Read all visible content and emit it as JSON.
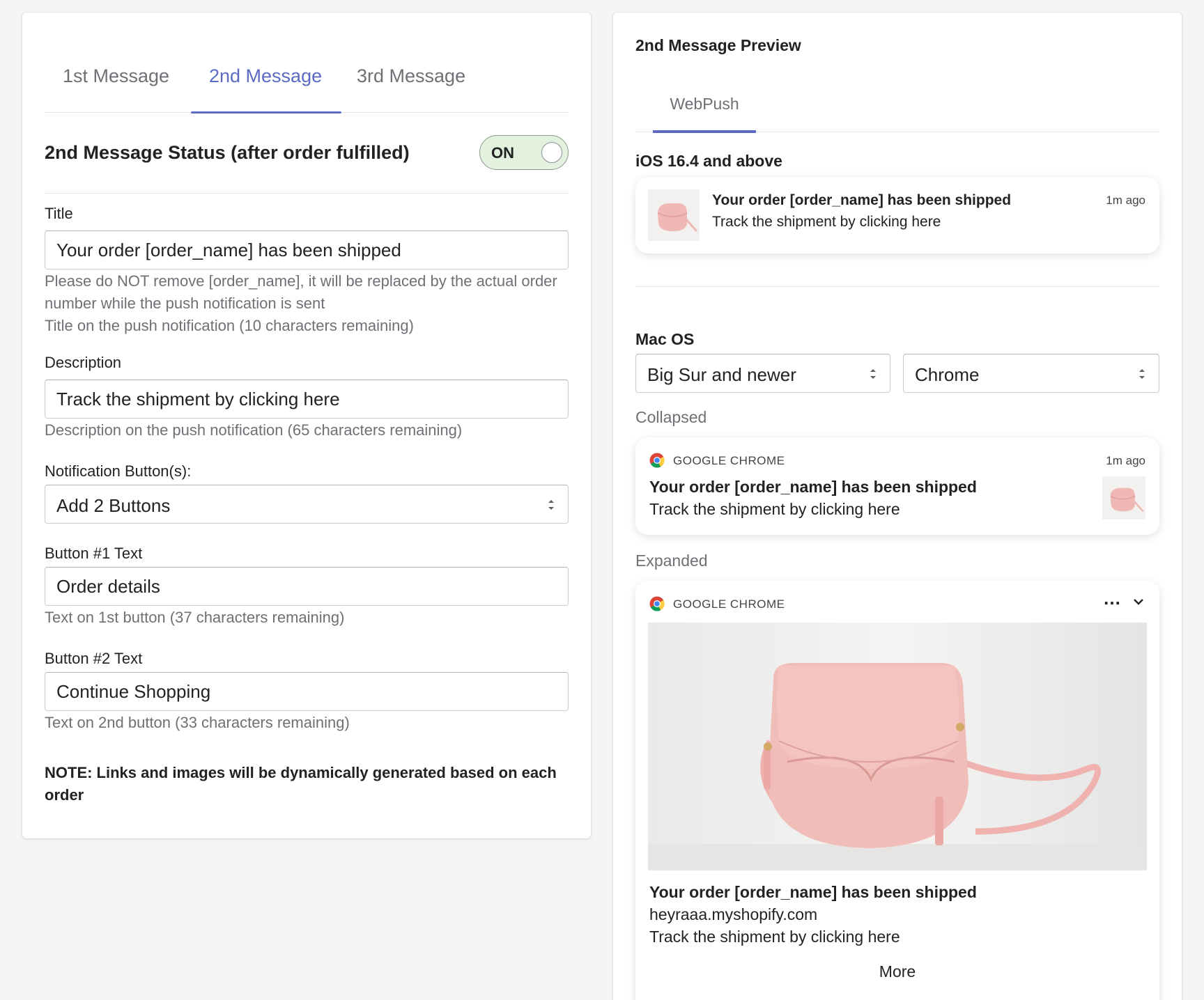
{
  "tabs": [
    {
      "label": "1st Message"
    },
    {
      "label": "2nd Message"
    },
    {
      "label": "3rd Message"
    }
  ],
  "active_tab": "2nd Message",
  "status": {
    "title": "2nd Message Status (after order fulfilled)",
    "toggle_label": "ON"
  },
  "form": {
    "title_label": "Title",
    "title_value": "Your order [order_name] has been shipped",
    "title_help_1": "Please do NOT remove [order_name], it will be replaced by the actual order number while the push notification is sent",
    "title_help_2": "Title on the push notification (10 characters remaining)",
    "description_label": "Description",
    "description_value": "Track the shipment by clicking here",
    "description_help": "Description on the push notification (65 characters remaining)",
    "buttons_label": "Notification Button(s):",
    "buttons_value": "Add 2 Buttons",
    "button1_label": "Button #1 Text",
    "button1_value": "Order details",
    "button1_help": "Text on 1st button (37 characters remaining)",
    "button2_label": "Button #2 Text",
    "button2_value": "Continue Shopping",
    "button2_help": "Text on 2nd button (33 characters remaining)",
    "note": "NOTE: Links and images will be dynamically generated based on each order"
  },
  "preview": {
    "title": "2nd Message Preview",
    "tab": "WebPush",
    "ios_heading": "iOS 16.4 and above",
    "ios_notification": {
      "title": "Your order [order_name] has been shipped",
      "body": "Track the shipment by clicking here",
      "time": "1m ago"
    },
    "mac_heading": "Mac OS",
    "os_select": "Big Sur and newer",
    "browser_select": "Chrome",
    "collapsed_label": "Collapsed",
    "collapsed_notification": {
      "app": "GOOGLE CHROME",
      "time": "1m ago",
      "title": "Your order [order_name] has been shipped",
      "body": "Track the shipment by clicking here"
    },
    "expanded_label": "Expanded",
    "expanded_notification": {
      "app": "GOOGLE CHROME",
      "menu": "…",
      "title": "Your order [order_name] has been shipped",
      "site": "heyraaa.myshopify.com",
      "body": "Track the shipment by clicking here",
      "more": "More"
    }
  },
  "colors": {
    "accent": "#5c6ac4",
    "toggle_on_bg": "#e3f1df",
    "bag_pink": "#efb8b5"
  },
  "icons": [
    "chrome-icon",
    "chevron-down-icon",
    "more-dots-icon",
    "select-arrows-icon"
  ]
}
